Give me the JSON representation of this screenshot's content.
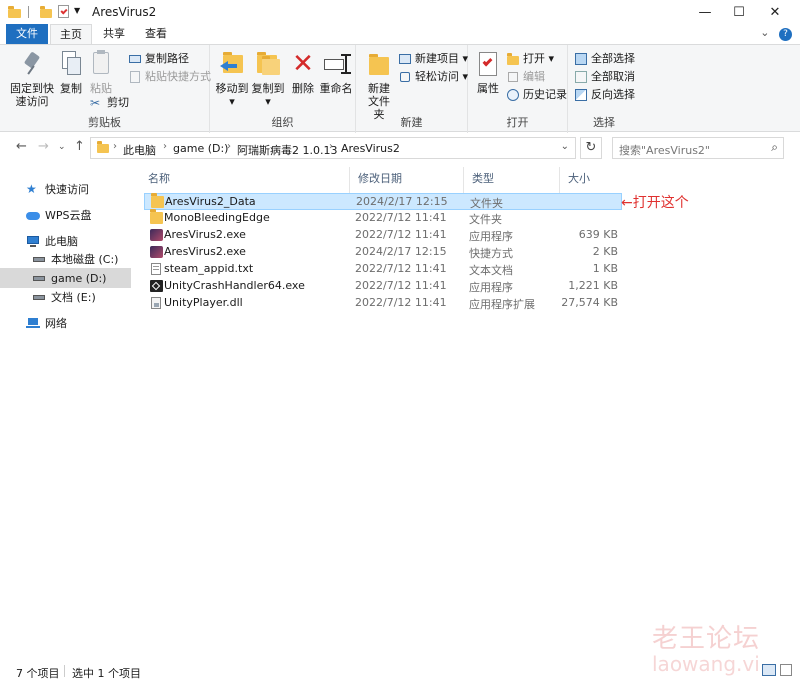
{
  "window": {
    "title": "AresVirus2"
  },
  "tabs": {
    "file": "文件",
    "home": "主页",
    "share": "共享",
    "view": "查看"
  },
  "ribbon": {
    "clipboard": {
      "pin_quick_access": "固定到快速访问",
      "copy": "复制",
      "paste": "粘贴",
      "copy_path": "复制路径",
      "paste_shortcut": "粘贴快捷方式",
      "cut": "剪切",
      "group": "剪贴板"
    },
    "organize": {
      "move_to": "移动到",
      "copy_to": "复制到",
      "delete": "删除",
      "rename": "重命名",
      "group": "组织"
    },
    "new": {
      "new_folder": "新建文件夹",
      "new_item": "新建项目",
      "easy_access": "轻松访问",
      "group": "新建"
    },
    "open": {
      "properties": "属性",
      "open": "打开",
      "edit": "编辑",
      "history": "历史记录",
      "group": "打开"
    },
    "select": {
      "select_all": "全部选择",
      "select_none": "全部取消",
      "invert": "反向选择",
      "group": "选择"
    }
  },
  "address": {
    "crumbs": [
      "此电脑",
      "game (D:)",
      "阿瑞斯病毒2 1.0.13",
      "AresVirus2"
    ],
    "search_placeholder": "搜索\"AresVirus2\""
  },
  "nav": {
    "items": [
      {
        "label": "快速访问",
        "icon": "star-icon"
      },
      {
        "label": "WPS云盘",
        "icon": "cloud-icon"
      },
      {
        "label": "此电脑",
        "icon": "computer-icon"
      },
      {
        "label": "本地磁盘 (C:)",
        "icon": "drive-icon"
      },
      {
        "label": "game (D:)",
        "icon": "drive-icon"
      },
      {
        "label": "文档 (E:)",
        "icon": "drive-icon"
      },
      {
        "label": "网络",
        "icon": "network-icon"
      }
    ]
  },
  "columns": {
    "name": "名称",
    "date": "修改日期",
    "type": "类型",
    "size": "大小"
  },
  "files": [
    {
      "name": "AresVirus2_Data",
      "date": "2024/2/17 12:15",
      "type": "文件夹",
      "size": "",
      "icon": "folder-icon"
    },
    {
      "name": "MonoBleedingEdge",
      "date": "2022/7/12 11:41",
      "type": "文件夹",
      "size": "",
      "icon": "folder-icon"
    },
    {
      "name": "AresVirus2.exe",
      "date": "2022/7/12 11:41",
      "type": "应用程序",
      "size": "639 KB",
      "icon": "app-icon"
    },
    {
      "name": "AresVirus2.exe",
      "date": "2024/2/17 12:15",
      "type": "快捷方式",
      "size": "2 KB",
      "icon": "app-icon"
    },
    {
      "name": "steam_appid.txt",
      "date": "2022/7/12 11:41",
      "type": "文本文档",
      "size": "1 KB",
      "icon": "text-file-icon"
    },
    {
      "name": "UnityCrashHandler64.exe",
      "date": "2022/7/12 11:41",
      "type": "应用程序",
      "size": "1,221 KB",
      "icon": "unity-icon"
    },
    {
      "name": "UnityPlayer.dll",
      "date": "2022/7/12 11:41",
      "type": "应用程序扩展",
      "size": "27,574 KB",
      "icon": "dll-icon"
    }
  ],
  "annotation": "←打开这个",
  "status": {
    "count": "7 个项目",
    "selected": "选中 1 个项目"
  },
  "watermark": {
    "line1": "老王论坛",
    "line2": "laowang.vi"
  },
  "colors": {
    "accent": "#1f6fc0",
    "selection": "#cce8ff",
    "annotation": "#e0312f"
  }
}
